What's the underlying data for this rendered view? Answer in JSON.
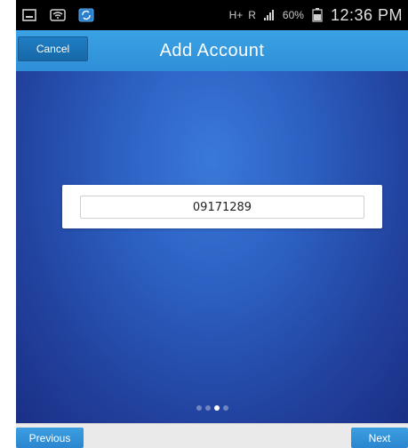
{
  "status_bar": {
    "left_icons": [
      "screenshot-icon",
      "wifi-icon",
      "sync-icon"
    ],
    "network_label": "H+",
    "roaming_label": "R",
    "battery_percent": "60%",
    "time": "12:36 PM"
  },
  "header": {
    "title": "Add Account",
    "cancel_label": "Cancel",
    "accent_color": "#3aa2e4"
  },
  "form": {
    "account_value": "09171289"
  },
  "page_indicator": {
    "total_pages": 4,
    "active_page": 3
  },
  "footer": {
    "previous_label": "Previous",
    "next_label": "Next"
  }
}
